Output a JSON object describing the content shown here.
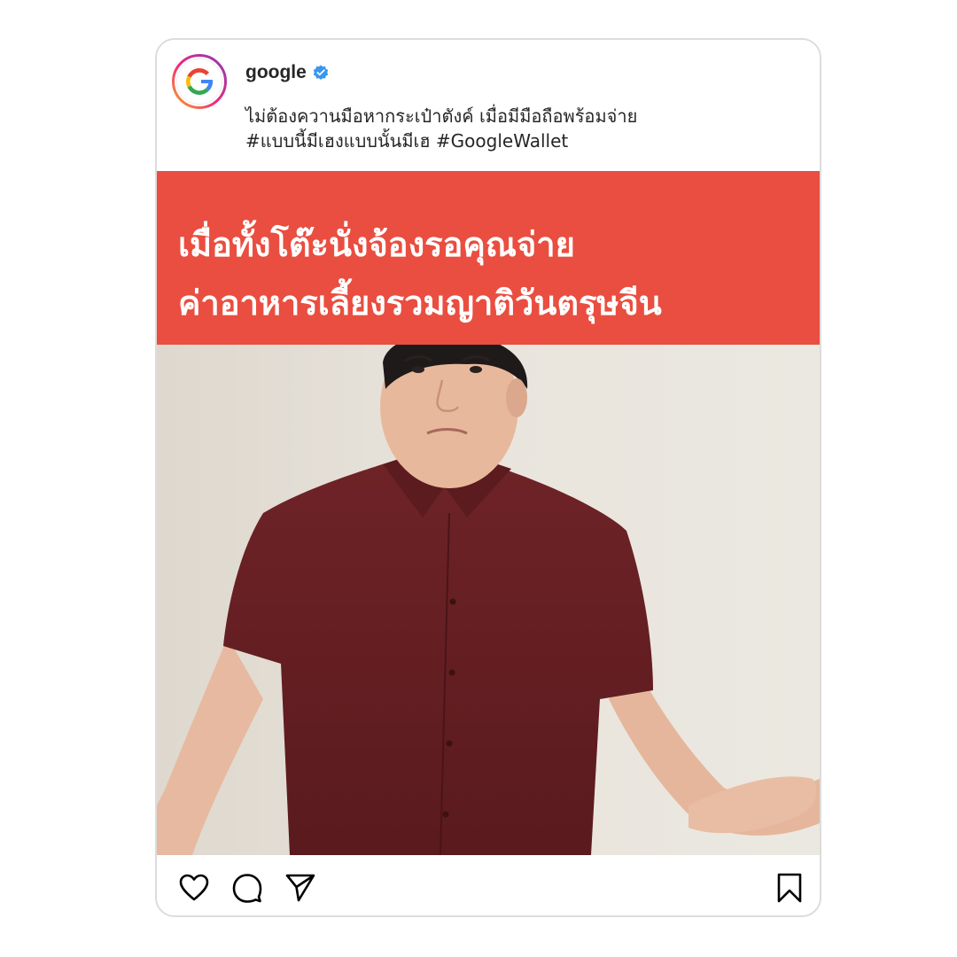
{
  "post": {
    "username": "google",
    "verified": true,
    "caption_lines": [
      "ไม่ต้องควานมือหากระเป๋าตังค์ เมื่อมีมือถือพร้อมจ่าย",
      "#แบบนี้มีเฮงแบบนั้นมีเฮ #GoogleWallet"
    ]
  },
  "media": {
    "overlay_lines": [
      "เมื่อทั้งโต๊ะนั่งจ้องรอคุณจ่าย",
      "ค่าอาหารเลี้ยงรวมญาติวันตรุษจีน"
    ],
    "banner_color": "#e94e40",
    "photo_description_icon": "person-red-shirt-shrugging"
  },
  "actions": {
    "like_icon": "heart-icon",
    "comment_icon": "comment-icon",
    "share_icon": "paper-plane-icon",
    "save_icon": "bookmark-icon"
  },
  "colors": {
    "verified_badge": "#3897f0",
    "text": "#262626",
    "card_border": "#dcdcdc"
  }
}
